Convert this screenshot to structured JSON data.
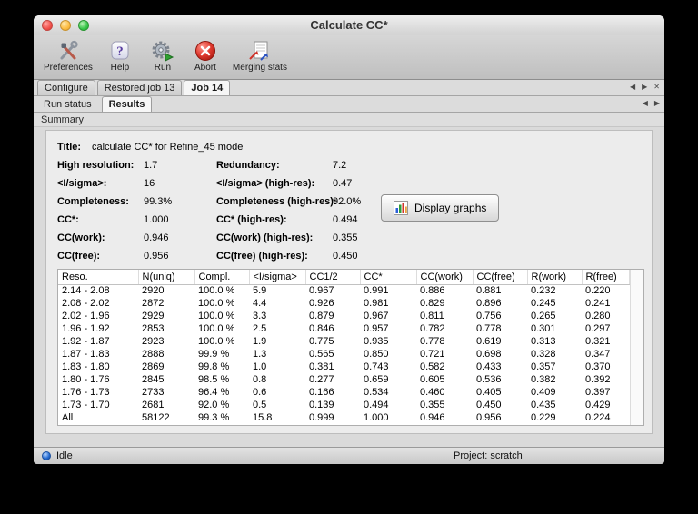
{
  "window": {
    "title": "Calculate CC*"
  },
  "toolbar": {
    "items": [
      {
        "label": "Preferences"
      },
      {
        "label": "Help"
      },
      {
        "label": "Run"
      },
      {
        "label": "Abort"
      },
      {
        "label": "Merging stats"
      }
    ]
  },
  "tabs": {
    "main": [
      {
        "label": "Configure"
      },
      {
        "label": "Restored job 13"
      },
      {
        "label": "Job 14"
      }
    ],
    "sub": [
      {
        "label": "Run status"
      },
      {
        "label": "Results"
      }
    ]
  },
  "icons": {
    "scroll_left": "◀",
    "scroll_right": "▶",
    "close": "✕"
  },
  "section": {
    "summary_label": "Summary"
  },
  "summary": {
    "title_label": "Title:",
    "title_value": "calculate CC* for Refine_45 model",
    "rows": [
      {
        "label1": "High resolution:",
        "value1": "1.7",
        "label2": "Redundancy:",
        "value2": "7.2"
      },
      {
        "label1": "<I/sigma>:",
        "value1": "16",
        "label2": "<I/sigma> (high-res):",
        "value2": "0.47"
      },
      {
        "label1": "Completeness:",
        "value1": "99.3%",
        "label2": "Completeness (high-res):",
        "value2": "92.0%"
      },
      {
        "label1": "CC*:",
        "value1": "1.000",
        "label2": "CC* (high-res):",
        "value2": "0.494"
      },
      {
        "label1": "CC(work):",
        "value1": "0.946",
        "label2": "CC(work) (high-res):",
        "value2": "0.355"
      },
      {
        "label1": "CC(free):",
        "value1": "0.956",
        "label2": "CC(free) (high-res):",
        "value2": "0.450"
      }
    ],
    "display_graphs_button": "Display graphs"
  },
  "table": {
    "columns": [
      "Reso.",
      "N(uniq)",
      "Compl.",
      "<I/sigma>",
      "CC1/2",
      "CC*",
      "CC(work)",
      "CC(free)",
      "R(work)",
      "R(free)"
    ],
    "rows": [
      [
        "2.14 - 2.08",
        "2920",
        "100.0 %",
        "5.9",
        "0.967",
        "0.991",
        "0.886",
        "0.881",
        "0.232",
        "0.220"
      ],
      [
        "2.08 - 2.02",
        "2872",
        "100.0 %",
        "4.4",
        "0.926",
        "0.981",
        "0.829",
        "0.896",
        "0.245",
        "0.241"
      ],
      [
        "2.02 - 1.96",
        "2929",
        "100.0 %",
        "3.3",
        "0.879",
        "0.967",
        "0.811",
        "0.756",
        "0.265",
        "0.280"
      ],
      [
        "1.96 - 1.92",
        "2853",
        "100.0 %",
        "2.5",
        "0.846",
        "0.957",
        "0.782",
        "0.778",
        "0.301",
        "0.297"
      ],
      [
        "1.92 - 1.87",
        "2923",
        "100.0 %",
        "1.9",
        "0.775",
        "0.935",
        "0.778",
        "0.619",
        "0.313",
        "0.321"
      ],
      [
        "1.87 - 1.83",
        "2888",
        "99.9 %",
        "1.3",
        "0.565",
        "0.850",
        "0.721",
        "0.698",
        "0.328",
        "0.347"
      ],
      [
        "1.83 - 1.80",
        "2869",
        "99.8 %",
        "1.0",
        "0.381",
        "0.743",
        "0.582",
        "0.433",
        "0.357",
        "0.370"
      ],
      [
        "1.80 - 1.76",
        "2845",
        "98.5 %",
        "0.8",
        "0.277",
        "0.659",
        "0.605",
        "0.536",
        "0.382",
        "0.392"
      ],
      [
        "1.76 - 1.73",
        "2733",
        "96.4 %",
        "0.6",
        "0.166",
        "0.534",
        "0.460",
        "0.405",
        "0.409",
        "0.397"
      ],
      [
        "1.73 - 1.70",
        "2681",
        "92.0 %",
        "0.5",
        "0.139",
        "0.494",
        "0.355",
        "0.450",
        "0.435",
        "0.429"
      ],
      [
        "All",
        "58122",
        "99.3 %",
        "15.8",
        "0.999",
        "1.000",
        "0.946",
        "0.956",
        "0.229",
        "0.224"
      ]
    ]
  },
  "status_bar": {
    "status": "Idle",
    "project": "Project: scratch"
  }
}
